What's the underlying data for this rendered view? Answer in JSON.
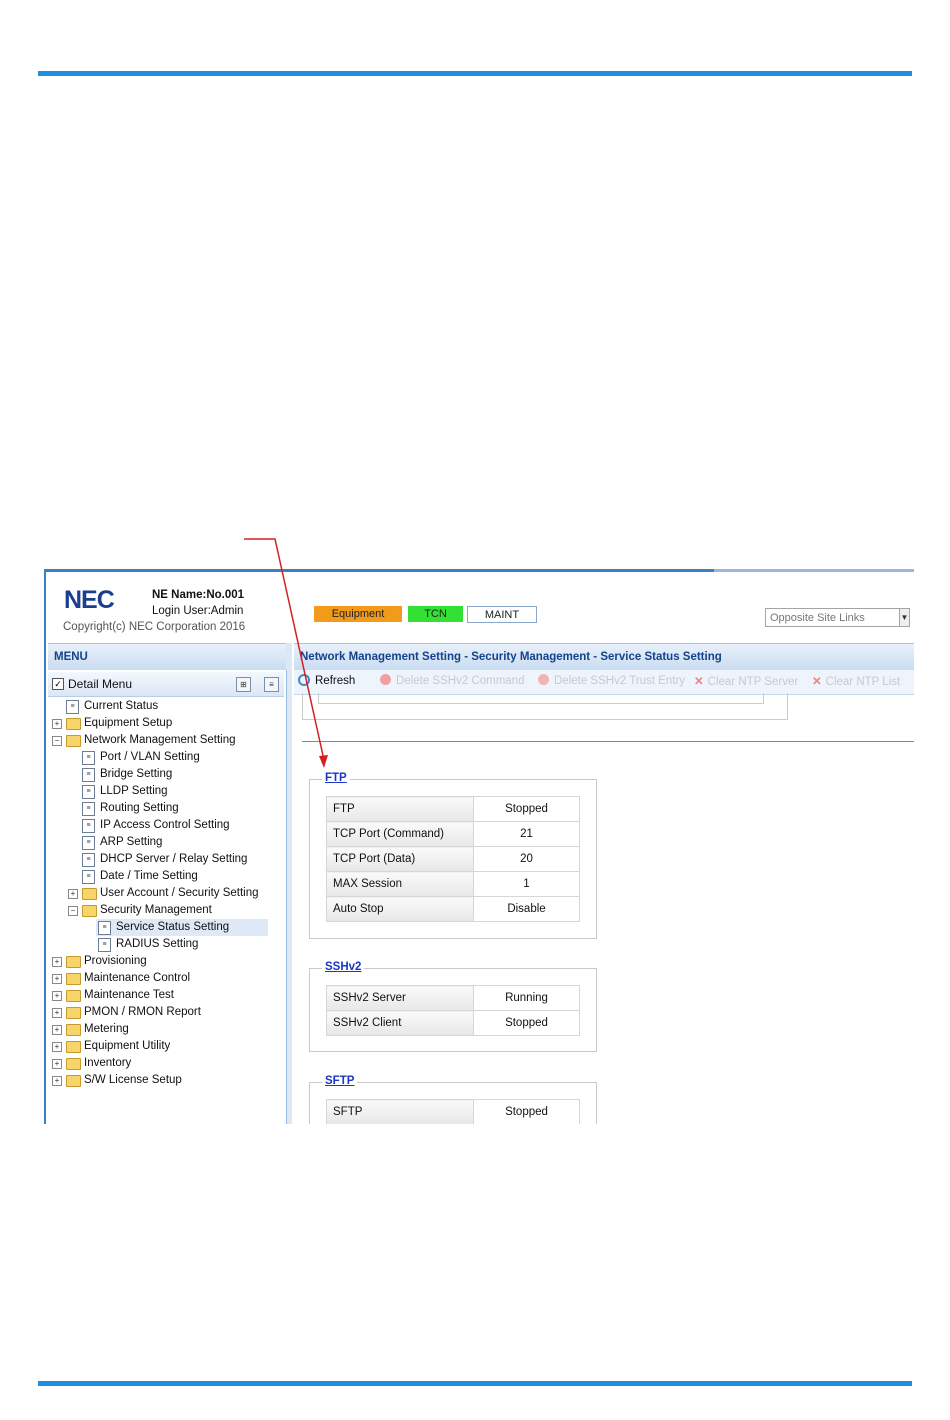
{
  "header": {
    "logo": "NEC",
    "ne_name": "NE Name:No.001",
    "login_user": "Login User:Admin",
    "copyright": "Copyright(c) NEC Corporation 2016",
    "badges": {
      "equipment": "Equipment",
      "tcn": "TCN",
      "maint": "MAINT"
    },
    "opposite_site": "Opposite Site Links"
  },
  "menu": {
    "title": "MENU",
    "detail_menu": "Detail Menu",
    "checkbox": "✓",
    "items": [
      "Current Status",
      "Equipment Setup",
      "Network Management Setting",
      "Port / VLAN Setting",
      "Bridge Setting",
      "LLDP Setting",
      "Routing Setting",
      "IP Access Control Setting",
      "ARP Setting",
      "DHCP Server / Relay Setting",
      "Date / Time Setting",
      "User Account / Security Setting",
      "Security Management",
      "Service Status Setting",
      "RADIUS Setting",
      "Provisioning",
      "Maintenance Control",
      "Maintenance Test",
      "PMON / RMON Report",
      "Metering",
      "Equipment Utility",
      "Inventory",
      "S/W License Setup"
    ]
  },
  "main": {
    "title": "Network Management Setting - Security Management - Service Status Setting",
    "toolbar": {
      "refresh": "Refresh",
      "delete_ssh_command": "Delete SSHv2 Command",
      "delete_ssh_trust": "Delete SSHv2 Trust Entry",
      "clear_ntp_server": "Clear NTP Server",
      "clear_ntp_list": "Clear NTP List"
    },
    "ftp": {
      "title": "FTP",
      "rows": [
        {
          "label": "FTP",
          "value": "Stopped"
        },
        {
          "label": "TCP Port (Command)",
          "value": "21"
        },
        {
          "label": "TCP Port (Data)",
          "value": "20"
        },
        {
          "label": "MAX Session",
          "value": "1"
        },
        {
          "label": "Auto Stop",
          "value": "Disable"
        }
      ]
    },
    "sshv2": {
      "title": "SSHv2",
      "rows": [
        {
          "label": "SSHv2 Server",
          "value": "Running"
        },
        {
          "label": "SSHv2 Client",
          "value": "Stopped"
        }
      ]
    },
    "sftp": {
      "title": "SFTP",
      "rows": [
        {
          "label": "SFTP",
          "value": "Stopped"
        }
      ]
    }
  },
  "colors": {
    "rule": "#1e8fe0",
    "equipment": "#f29a1a",
    "tcn": "#33e033",
    "arrow": "#d42020"
  }
}
